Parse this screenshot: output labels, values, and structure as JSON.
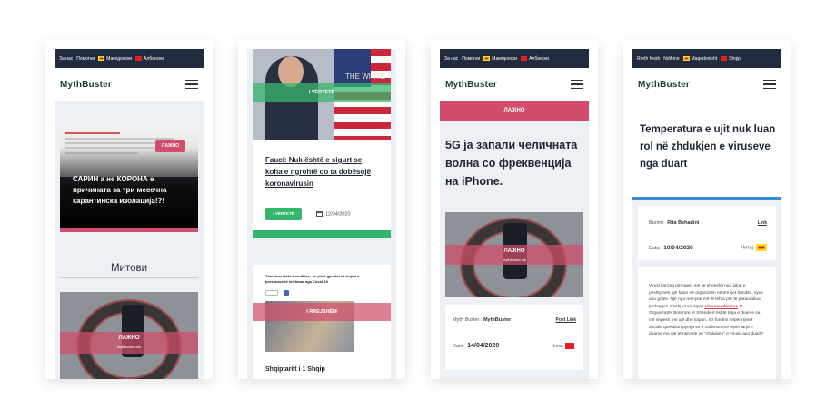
{
  "nav_mk": {
    "about": "За нас",
    "help": "Помогни",
    "macedonian": "Македонски",
    "albanian": "Албански"
  },
  "nav_sq": {
    "about": "Rreth Nesh",
    "help": "Ndihmo",
    "macedonian": "Maqedonisht",
    "albanian": "Shqip"
  },
  "logo": "MythBuster",
  "screen1": {
    "card_badge": "ЛАЖНО",
    "card_title": "САРИН а не КОРОНА е причината за три месечна карантинска изолација!?!",
    "section_heading": "Митови",
    "image_badge": "ЛАЖНО",
    "image_caption": "mythbuster.mk"
  },
  "screen2": {
    "hero_badge": "I VËRTETË",
    "hero_backdrop_text": "THE WHITE",
    "title": "Fauci: Nuk është e sigurt se koha e ngrohtë do ta dobësojë koronavirusin",
    "tag": "I VËRTETË",
    "date": "12/04/2020",
    "card2_text": "Zbulohen fakte tronditëse: Je çfarë gjendet në trupat e personave të infektuar nga Covid-19",
    "card2_badge": "I RREJSHËM",
    "card2_cut_title": "Shqiptarët i 1 Shqip"
  },
  "screen3": {
    "badge": "ЛАЖНО",
    "title": "5G ја запали челичната волна со фреквенција на iPhone.",
    "image_badge": "ЛАЖНО",
    "image_caption": "mythbuster.mk",
    "author_label": "Myth Buster:",
    "author": "MythBuster",
    "link": "Post Link",
    "date_label": "Date:",
    "date": "14/04/2020",
    "read_label": "Lexo"
  },
  "screen4": {
    "title": "Temperatura e ujit nuk luan rol në zhdukjen e viruseve nga duart",
    "source_label": "Burimi:",
    "source": "Rita Behadini",
    "link": "Link",
    "date_label": "Data:",
    "date": "10/04/2020",
    "read_label": "Читај",
    "body_before": "Virusi korona përhapet më së shpeshti nga pikat e pështymës, që futen në organizëm nëpërmjet hundës, syve apo gojës. Një nga mënyrat më të lehta për të parandaluar përhapjen e këtij virusi sipas",
    "body_link": "rekomandimeve",
    "body_after": "të Organizatës Botërore të Shëndetit është larja e duarve sa më shpesh me ujë dhe sapun. Së fundmi nëpër rrjetet sociale qarkullon pyetja se a ndihmon më tepër larja e duarve me ujë të ngrohtë në \"zhdukjen\" e virusit apo duart?"
  },
  "colors": {
    "false_red": "#d14d6b",
    "true_green": "#34b56c",
    "nav_dark": "#222c3f",
    "accent_blue": "#3a8bd0"
  },
  "icons": [
    "hamburger-menu-icon",
    "calendar-icon",
    "flag-mk-icon",
    "flag-al-icon"
  ]
}
